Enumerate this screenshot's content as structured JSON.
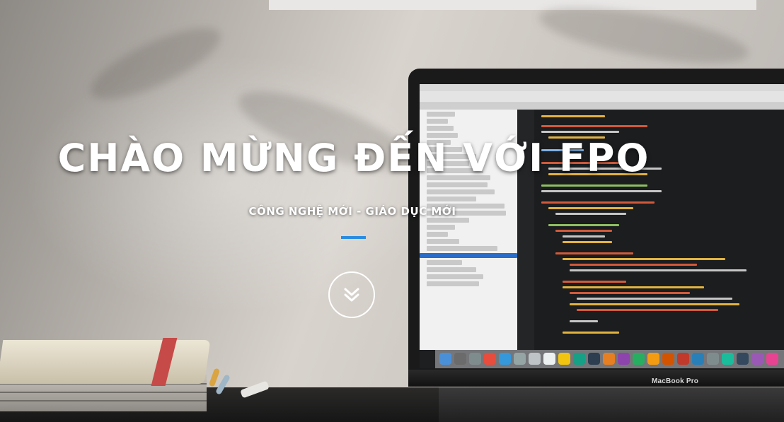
{
  "hero": {
    "title": "CHÀO MỪNG ĐẾN VỚI FPO",
    "subtitle": "CÔNG NGHỆ MỚI - GIÁO DỤC MỚI",
    "accent_color": "#2c8be0",
    "scroll_icon": "chevron-double-down-icon"
  },
  "background": {
    "laptop_brand": "MacBook Pro"
  }
}
